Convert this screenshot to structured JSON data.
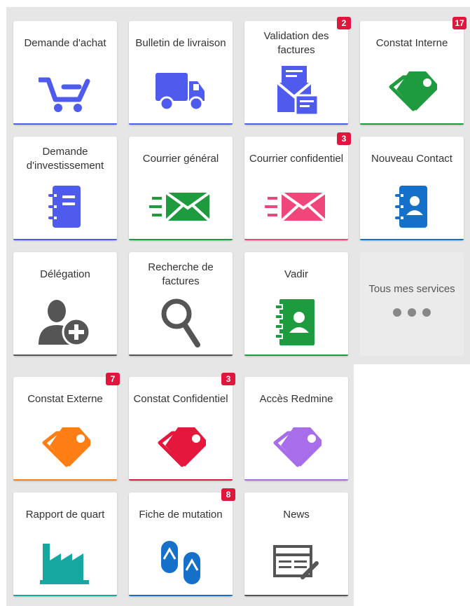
{
  "colors": {
    "blue": "#4f5bec",
    "green": "#1f9b3f",
    "pink": "#f0467a",
    "darkblue": "#1570c9",
    "orange": "#fd7e14",
    "red": "#e6173d",
    "purple": "#a86de8",
    "teal": "#16a8a0",
    "gray": "#555555",
    "badge": "#e0163d"
  },
  "tiles": [
    {
      "label": "Demande d'achat",
      "icon": "shopping-cart-icon"
    },
    {
      "label": "Bulletin de livraison",
      "icon": "delivery-truck-icon"
    },
    {
      "label": "Validation des factures",
      "icon": "invoice-envelope-icon",
      "badge": "2"
    },
    {
      "label": "Constat Interne",
      "icon": "tag-icon",
      "badge": "17"
    },
    {
      "label": "Demande d'investissement",
      "icon": "notebook-icon"
    },
    {
      "label": "Courrier général",
      "icon": "sent-mail-icon"
    },
    {
      "label": "Courrier confidentiel",
      "icon": "sent-mail-icon",
      "badge": "3"
    },
    {
      "label": "Nouveau Contact",
      "icon": "contact-book-icon"
    },
    {
      "label": "Délégation",
      "icon": "add-user-icon"
    },
    {
      "label": "Recherche de factures",
      "icon": "search-icon"
    },
    {
      "label": "Vadir",
      "icon": "address-book-icon"
    },
    {
      "label": "Tous mes services",
      "icon": "more-dots-icon"
    },
    {
      "label": "Constat Externe",
      "icon": "tag-icon",
      "badge": "7"
    },
    {
      "label": "Constat Confidentiel",
      "icon": "tag-icon",
      "badge": "3"
    },
    {
      "label": "Accès Redmine",
      "icon": "tag-icon"
    },
    {
      "label": "Rapport de quart",
      "icon": "factory-icon"
    },
    {
      "label": "Fiche de mutation",
      "icon": "flip-flops-icon",
      "badge": "8"
    },
    {
      "label": "News",
      "icon": "newspaper-icon"
    }
  ]
}
